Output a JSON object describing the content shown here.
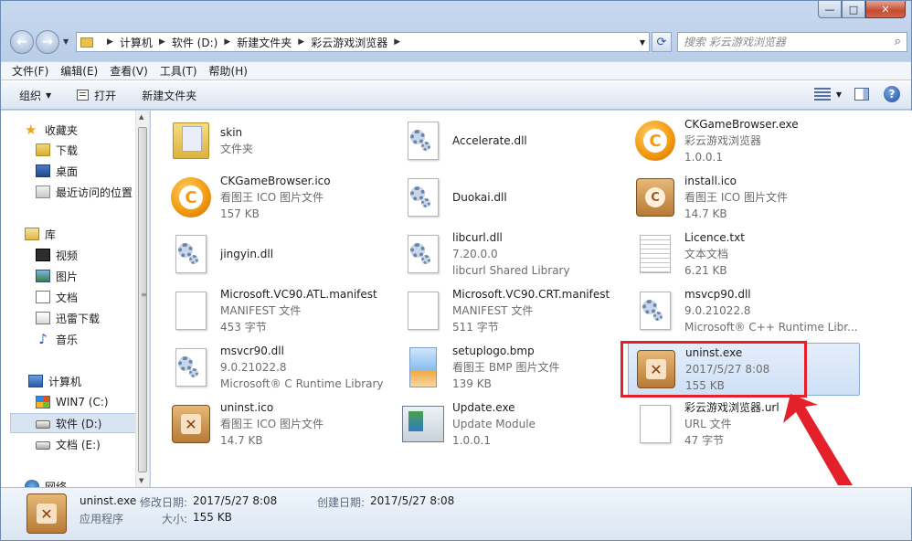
{
  "window": {
    "caption": {
      "minimize": "—",
      "maximize": "□",
      "close": "✕"
    }
  },
  "address": {
    "crumbs": [
      "计算机",
      "软件 (D:)",
      "新建文件夹",
      "彩云游戏浏览器"
    ],
    "search_placeholder": "搜索 彩云游戏浏览器"
  },
  "menu": [
    "文件(F)",
    "编辑(E)",
    "查看(V)",
    "工具(T)",
    "帮助(H)"
  ],
  "toolbar": {
    "organize": "组织",
    "open": "打开",
    "new_folder": "新建文件夹"
  },
  "nav": {
    "favorites": {
      "label": "收藏夹",
      "items": [
        "下载",
        "桌面",
        "最近访问的位置"
      ]
    },
    "libraries": {
      "label": "库",
      "items": [
        "视频",
        "图片",
        "文档",
        "迅雷下载",
        "音乐"
      ]
    },
    "computer": {
      "label": "计算机",
      "items": [
        "WIN7 (C:)",
        "软件 (D:)",
        "文档 (E:)"
      ]
    },
    "network": {
      "label": "网络"
    },
    "selected": "软件 (D:)"
  },
  "files": [
    {
      "name": "skin",
      "line2": "文件夹",
      "line3": "",
      "icon": "folder-icon"
    },
    {
      "name": "Accelerate.dll",
      "line2": "",
      "line3": "",
      "icon": "dll-icon"
    },
    {
      "name": "CKGameBrowser.exe",
      "line2": "彩云游戏浏览器",
      "line3": "1.0.0.1",
      "icon": "ckgame-app-icon"
    },
    {
      "name": "CKGameBrowser.ico",
      "line2": "看图王 ICO 图片文件",
      "line3": "157 KB",
      "icon": "ckgame-app-icon"
    },
    {
      "name": "Duokai.dll",
      "line2": "",
      "line3": "",
      "icon": "dll-icon"
    },
    {
      "name": "install.ico",
      "line2": "看图王 ICO 图片文件",
      "line3": "14.7 KB",
      "icon": "install-box-icon"
    },
    {
      "name": "jingyin.dll",
      "line2": "",
      "line3": "",
      "icon": "dll-icon"
    },
    {
      "name": "libcurl.dll",
      "line2": "7.20.0.0",
      "line3": "libcurl Shared Library",
      "icon": "dll-icon"
    },
    {
      "name": "Licence.txt",
      "line2": "文本文档",
      "line3": "6.21 KB",
      "icon": "text-file-icon"
    },
    {
      "name": "Microsoft.VC90.ATL.manifest",
      "line2": "MANIFEST 文件",
      "line3": "453 字节",
      "icon": "blank-file-icon"
    },
    {
      "name": "Microsoft.VC90.CRT.manifest",
      "line2": "MANIFEST 文件",
      "line3": "511 字节",
      "icon": "blank-file-icon"
    },
    {
      "name": "msvcp90.dll",
      "line2": "9.0.21022.8",
      "line3": "Microsoft® C++ Runtime Libr...",
      "icon": "dll-icon"
    },
    {
      "name": "msvcr90.dll",
      "line2": "9.0.21022.8",
      "line3": "Microsoft® C Runtime Library",
      "icon": "dll-icon"
    },
    {
      "name": "setuplogo.bmp",
      "line2": "看图王 BMP 图片文件",
      "line3": "139 KB",
      "icon": "bitmap-icon"
    },
    {
      "name": "uninst.exe",
      "line2": "2017/5/27 8:08",
      "line3": "155 KB",
      "icon": "uninstall-box-icon",
      "selected": true
    },
    {
      "name": "uninst.ico",
      "line2": "看图王 ICO 图片文件",
      "line3": "14.7 KB",
      "icon": "uninstall-box-icon"
    },
    {
      "name": "Update.exe",
      "line2": "Update Module",
      "line3": "1.0.0.1",
      "icon": "update-app-icon"
    },
    {
      "name": "彩云游戏浏览器.url",
      "line2": "URL 文件",
      "line3": "47 字节",
      "icon": "url-file-icon"
    }
  ],
  "details": {
    "name": "uninst.exe",
    "type": "应用程序",
    "modified_label": "修改日期:",
    "modified": "2017/5/27 8:08",
    "created_label": "创建日期:",
    "created": "2017/5/27 8:08",
    "size_label": "大小:",
    "size": "155 KB"
  },
  "colors": {
    "annotation": "#e4212b",
    "selection": "#cfe0f6"
  }
}
